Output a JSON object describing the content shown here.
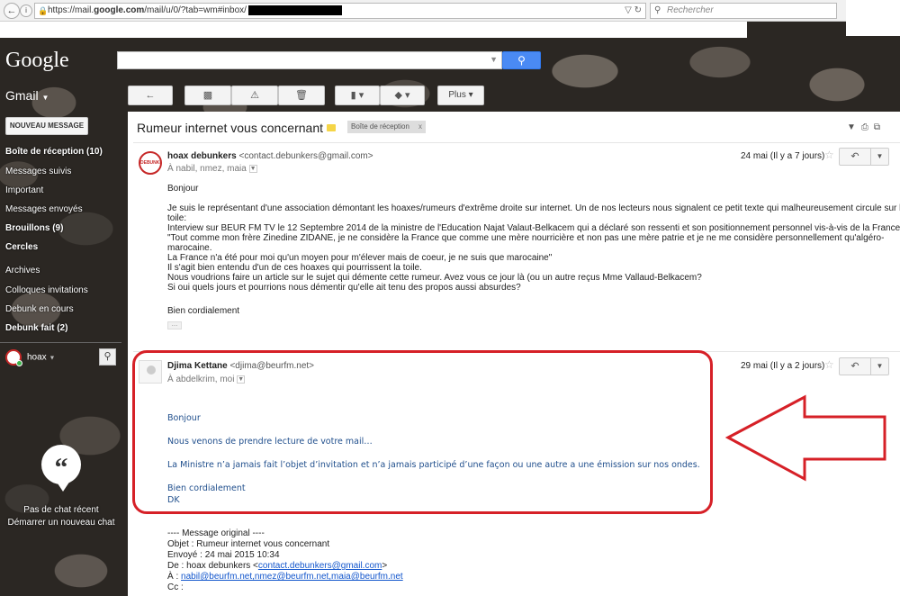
{
  "browser": {
    "back_icon": "back-arrow-icon",
    "lock_icon": "lock-icon",
    "url_prefix": "https://mail.",
    "url_domain": "google.com",
    "url_rest": "/mail/u/0/?tab=wm#inbox/",
    "search_placeholder": "Rechercher"
  },
  "gmail": {
    "logo": "Google",
    "app_label": "Gmail",
    "search_button_icon": "search-icon",
    "toolbar": {
      "more_label": "Plus"
    }
  },
  "sidebar": {
    "compose_label": "NOUVEAU MESSAGE",
    "items": [
      {
        "label": "Boîte de réception (10)",
        "bold": true
      },
      {
        "label": "Messages suivis",
        "bold": false
      },
      {
        "label": "Important",
        "bold": false
      },
      {
        "label": "Messages envoyés",
        "bold": false
      },
      {
        "label": "Brouillons (9)",
        "bold": true
      },
      {
        "label": "Cercles",
        "bold": true
      },
      {
        "label": "Archives",
        "bold": false
      },
      {
        "label": "Colloques invitations",
        "bold": false
      },
      {
        "label": "Debunk en cours",
        "bold": false
      },
      {
        "label": "Debunk fait (2)",
        "bold": true
      }
    ],
    "user": "hoax",
    "chat_empty": "Pas de chat récent",
    "chat_start": "Démarrer un nouveau chat"
  },
  "thread": {
    "subject": "Rumeur internet vous concernant",
    "inbox_tag": "Boîte de réception",
    "tag_close": "x",
    "messages": [
      {
        "sender_name": "hoax debunkers",
        "sender_email": "<contact.debunkers@gmail.com>",
        "to": "À nabil, nmez, maia",
        "date": "24 mai (Il y a 7 jours)",
        "avatar_text": "DEBUNKERS",
        "lines": [
          "Bonjour",
          "",
          "Je suis le représentant d'une association démontant les hoaxes/rumeurs d'extrême droite sur internet. Un de nos lecteurs nous signalent ce petit texte qui malheureusement circule sur la",
          "toile:",
          "Interview sur BEUR FM TV le 12 Septembre 2014 de la ministre de l'Education Najat Valaut-Belkacem qui a déclaré son ressenti et son positionnement personnel vis-à-vis de la France :",
          "\"Tout comme mon frère Zinedine ZIDANE, je ne considère la France que comme une mère nourricière et non pas une mère patrie et je ne me considère personnellement qu'algéro-",
          "marocaine.",
          "La France n'a été pour moi qu'un moyen pour m'élever mais de coeur, je ne suis que marocaine\"",
          "Il s'agit bien entendu d'un de ces hoaxes qui pourrissent la toile.",
          "Nous voudrions faire un article sur le sujet qui démente cette rumeur. Avez vous ce jour là (ou un autre reçus Mme Vallaud-Belkacem?",
          "Si oui quels jours et pourrions nous démentir qu'elle ait tenu des propos aussi absurdes?",
          "",
          "Bien cordialement"
        ]
      },
      {
        "sender_name": "Djima Kettane",
        "sender_email": "<djima@beurfm.net>",
        "to": "À abdelkrim, moi",
        "date": "29 mai (Il y a 2 jours)",
        "lines": [
          "Bonjour",
          "Nous venons de prendre lecture de votre mail…",
          "La Ministre n’a jamais fait l’objet d’invitation et n’a jamais participé d’une façon ou une autre a une émission sur nos ondes.",
          "Bien cordialement",
          "DK"
        ],
        "quoted": {
          "header": "---- Message original ----",
          "objet": "Objet : Rumeur internet vous concernant",
          "envoye": "Envoyé : 24 mai 2015 10:34",
          "de_prefix": "De : hoax debunkers <",
          "de_link": "contact.debunkers@gmail.com",
          "de_suffix": ">",
          "a_prefix": "À : ",
          "a_link": "nabil@beurfm.net,nmez@beurfm.net,maia@beurfm.net",
          "cc": "Cc :"
        }
      }
    ]
  },
  "colors": {
    "annotation_red": "#d62027",
    "link_blue": "#1155cc",
    "reply_blue": "#1f4e8c",
    "search_blue": "#4a8af4"
  }
}
